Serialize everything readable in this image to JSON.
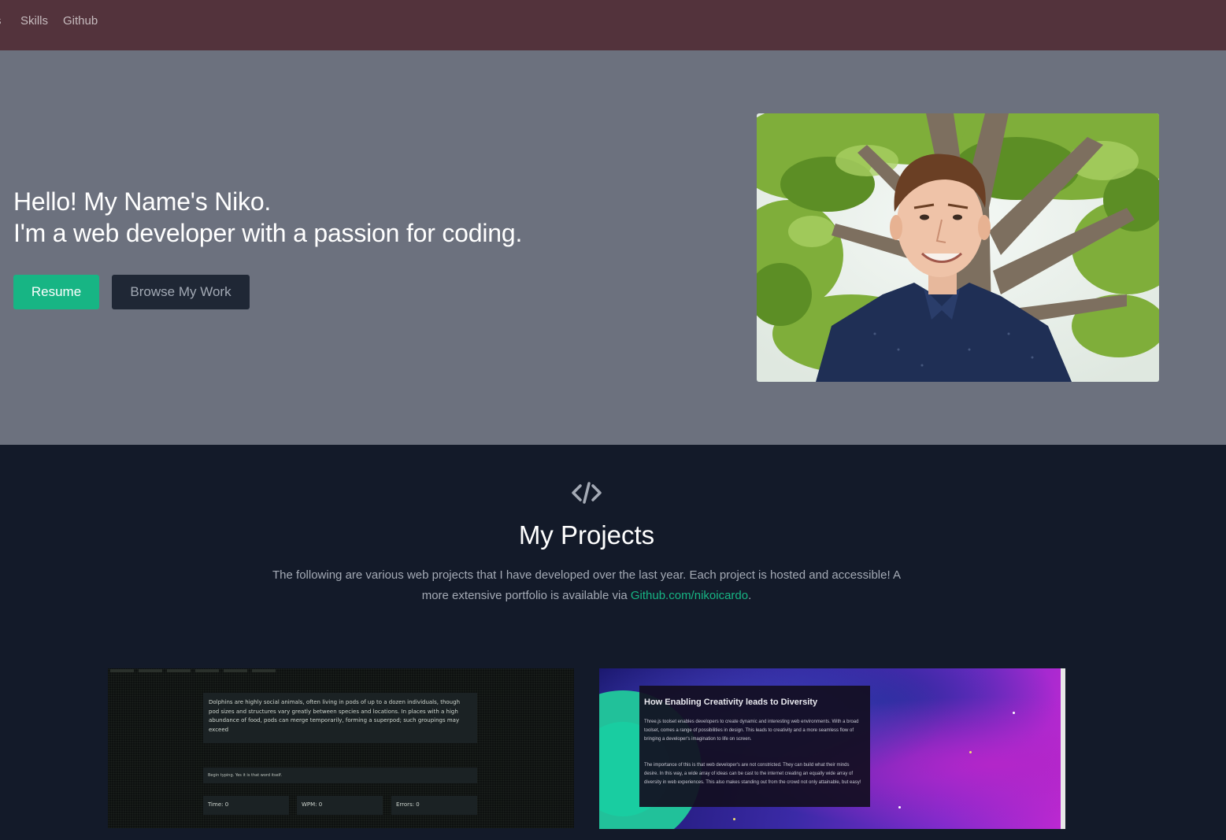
{
  "nav": {
    "cut_label": "s",
    "items": [
      {
        "label": "Skills"
      },
      {
        "label": "Github"
      }
    ]
  },
  "hero": {
    "line1": "Hello! My Name's Niko.",
    "line2": "I'm a web developer with a passion for coding.",
    "resume_label": "Resume",
    "browse_label": "Browse My Work"
  },
  "projects": {
    "icon": "code-icon",
    "title": "My Projects",
    "desc_before": "The following are various web projects that I have developed over the last year. Each project is hosted and accessible! A more extensive portfolio is available via ",
    "link_text": "Github.com/nikoicardo",
    "desc_after": "."
  },
  "thumb1": {
    "paragraph": "Dolphins are highly social animals, often living in pods of up to a dozen individuals, though pod sizes and structures vary greatly between species and locations. In places with a high abundance of food, pods can merge temporarily, forming a superpod; such groupings may exceed",
    "prompt": "Begin typing. Yes it is that word itself.",
    "time_label": "Time: 0",
    "wpm_label": "WPM: 0",
    "errors_label": "Errors: 0"
  },
  "thumb2": {
    "title": "How Enabling Creativity leads to Diversity",
    "p1": "Three.js toolset enables developers to create dynamic and interesting web environments. With a broad toolset, comes a range of possibilities in design. This leads to creativity and a more seamless flow of bringing a developer's imagination to life on screen.",
    "p2": "The importance of this is that web developer's are not constricted. They can build what their minds desire. In this way, a wide array of ideas can be cast to the internet creating an equally wide array of diversity in web experiences. This also makes standing out from the crowd not only attainable, but easy!"
  },
  "colors": {
    "nav_bg": "#53333c",
    "hero_bg": "#6c717e",
    "projects_bg": "#131a29",
    "accent": "#17b584",
    "dark_button": "#1f2735"
  }
}
